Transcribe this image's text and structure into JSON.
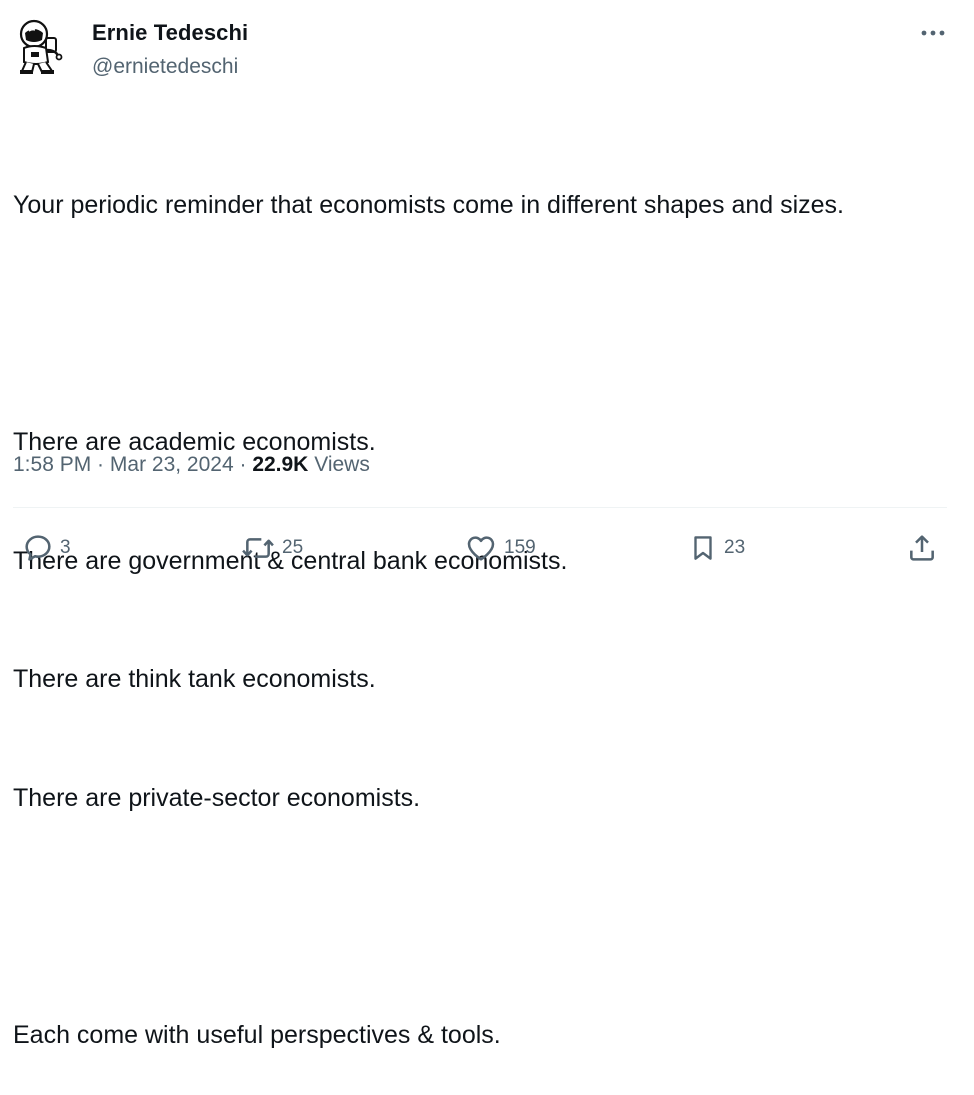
{
  "author": {
    "display_name": "Ernie Tedeschi",
    "handle": "@ernietedeschi",
    "avatar_icon": "astronaut-avatar-icon"
  },
  "tweet": {
    "lines": [
      "Your periodic reminder that economists come in different shapes and sizes.",
      "",
      "There are academic economists.",
      "There are government & central bank economists.",
      "There are think tank economists.",
      "There are private-sector economists.",
      "",
      "Each come with useful perspectives & tools."
    ]
  },
  "meta": {
    "time": "1:58 PM",
    "separator": " · ",
    "date": "Mar 23, 2024",
    "views_count": "22.9K",
    "views_label": "Views"
  },
  "actions": {
    "reply": {
      "icon": "reply-icon",
      "count": "3"
    },
    "retweet": {
      "icon": "retweet-icon",
      "count": "25"
    },
    "like": {
      "icon": "heart-icon",
      "count": "159"
    },
    "bookmark": {
      "icon": "bookmark-icon",
      "count": "23"
    },
    "share": {
      "icon": "share-icon"
    }
  },
  "colors": {
    "text_primary": "#0f1419",
    "text_secondary": "#536471",
    "divider": "#eff3f4"
  }
}
